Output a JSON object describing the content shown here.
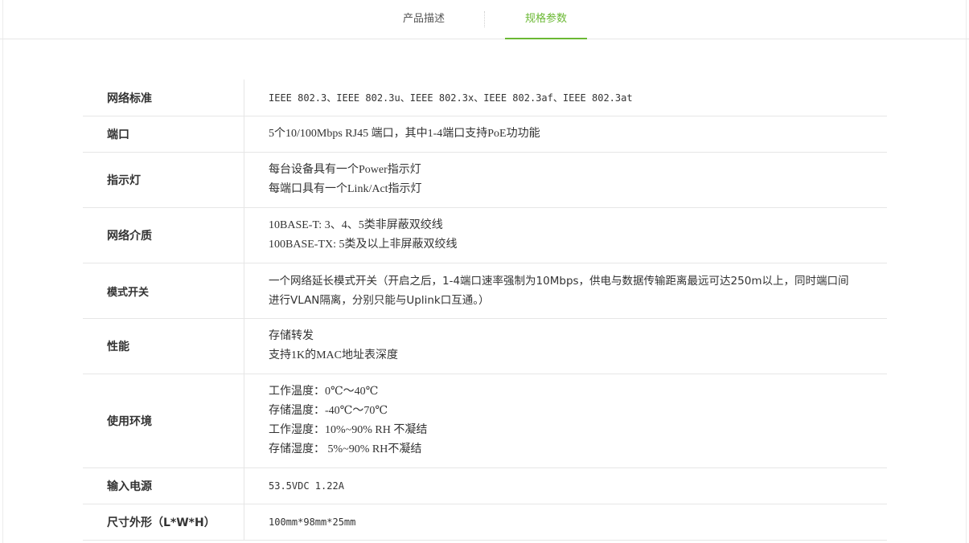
{
  "tabs": {
    "description_label": "产品描述",
    "specs_label": "规格参数",
    "active": "specs"
  },
  "colors": {
    "accent": "#6ab833",
    "border": "#e6e6e6",
    "text": "#333333"
  },
  "specs": [
    {
      "key": "网络标准",
      "lines": [
        "IEEE 802.3、IEEE 802.3u、IEEE 802.3x、IEEE 802.3af、IEEE 802.3at"
      ]
    },
    {
      "key": "端口",
      "lines": [
        "5个10/100Mbps RJ45 端口，其中1-4端口支持PoE功功能"
      ]
    },
    {
      "key": "指示灯",
      "lines": [
        "每台设备具有一个Power指示灯",
        "每端口具有一个Link/Act指示灯"
      ]
    },
    {
      "key": "网络介质",
      "lines": [
        "10BASE-T: 3、4、5类非屏蔽双绞线",
        "100BASE-TX: 5类及以上非屏蔽双绞线"
      ]
    },
    {
      "key": "模式开关",
      "lines": [
        "一个网络延长模式开关（开启之后，1-4端口速率强制为10Mbps，供电与数据传输距离最远可达250m以上，同时端口间",
        "进行VLAN隔离，分别只能与Uplink口互通。）"
      ]
    },
    {
      "key": "性能",
      "lines": [
        "存储转发",
        "支持1K的MAC地址表深度"
      ]
    },
    {
      "key": "使用环境",
      "lines": [
        "工作温度：0℃～40℃",
        "存储温度：-40℃～70℃",
        "工作湿度：10%~90% RH 不凝结",
        "存储湿度： 5%~90% RH不凝结"
      ]
    },
    {
      "key": "输入电源",
      "lines": [
        "53.5VDC 1.22A"
      ]
    },
    {
      "key": "尺寸外形（L*W*H）",
      "lines": [
        "100mm*98mm*25mm"
      ]
    }
  ]
}
